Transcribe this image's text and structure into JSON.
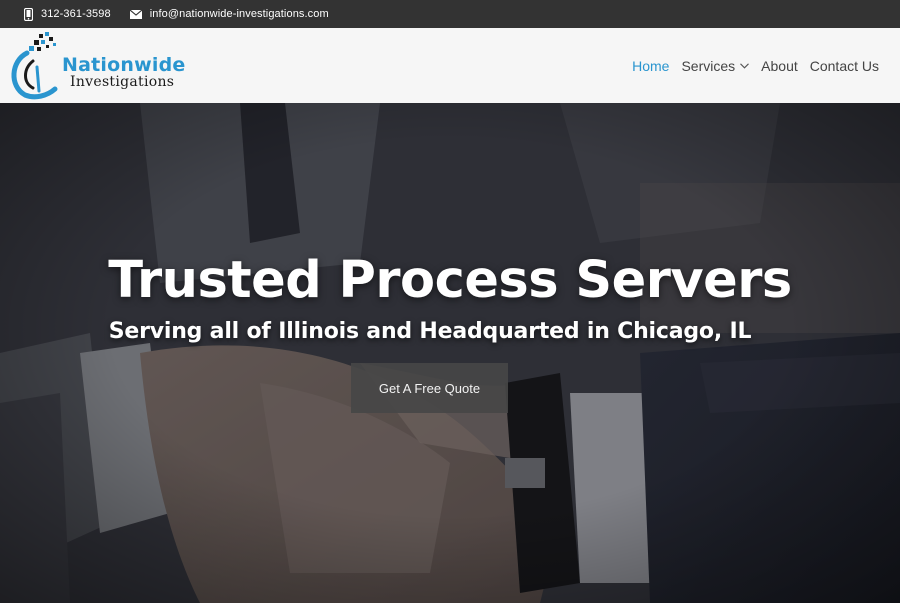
{
  "topbar": {
    "phone_icon": "phone-icon",
    "phone": "312-361-3598",
    "email_icon": "envelope-icon",
    "email": "info@nationwide-investigations.com"
  },
  "logo": {
    "line1": "Nationwide",
    "line2": "Investigations"
  },
  "nav": {
    "items": [
      {
        "label": "Home",
        "active": true
      },
      {
        "label": "Services",
        "has_dropdown": true
      },
      {
        "label": "About"
      },
      {
        "label": "Contact Us"
      }
    ]
  },
  "hero": {
    "title": "Trusted Process Servers",
    "subtitle": "Serving all of Illinois and Headquarted in Chicago, IL",
    "cta_label": "Get A Free Quote"
  },
  "colors": {
    "accent": "#2a95cf",
    "topbar_bg": "#333333",
    "header_bg": "#f6f6f6"
  }
}
